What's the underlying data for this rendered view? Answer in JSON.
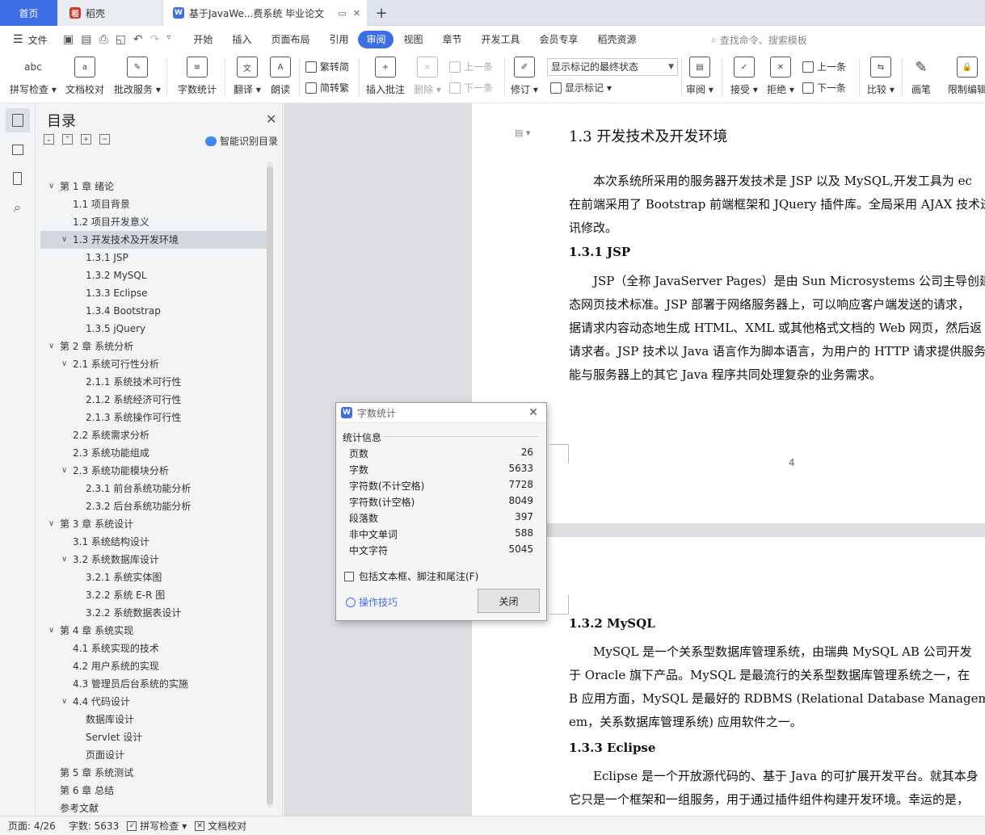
{
  "tabs": {
    "home": "首页",
    "daoke": "稻壳",
    "doc": "基于JavaWe...费系统 毕业论文"
  },
  "menu": {
    "file": "文件",
    "items": [
      "开始",
      "插入",
      "页面布局",
      "引用",
      "审阅",
      "视图",
      "章节",
      "开发工具",
      "会员专享",
      "稻壳资源"
    ],
    "active": "审阅",
    "search": "查找命令、搜索模板"
  },
  "ribbon": {
    "spell": "拼写检查",
    "doc_check": "文档校对",
    "batch": "批改服务",
    "word_count": "字数统计",
    "translate": "翻译",
    "read": "朗读",
    "trad": "繁转简",
    "simp": "简转繁",
    "insert_comment": "插入批注",
    "delete": "删除",
    "prev": "上一条",
    "next": "下一条",
    "revise": "修订",
    "markup_state": "显示标记的最终状态",
    "show_markup": "显示标记",
    "review": "审阅",
    "accept": "接受",
    "reject": "拒绝",
    "prev2": "上一条",
    "next2": "下一条",
    "compare": "比较",
    "pen": "画笔",
    "restrict": "限制编辑"
  },
  "toc": {
    "title": "目录",
    "smart": "智能识别目录",
    "items": [
      {
        "text": "第 1 章  绪论",
        "level": 1,
        "arrow": "v"
      },
      {
        "text": "1.1  项目背景",
        "level": 2
      },
      {
        "text": "1.2  项目开发意义",
        "level": 2
      },
      {
        "text": "1.3  开发技术及开发环境",
        "level": 2,
        "arrow": "v",
        "active": true
      },
      {
        "text": "1.3.1 JSP",
        "level": 3
      },
      {
        "text": "1.3.2     MySQL",
        "level": 3
      },
      {
        "text": "1.3.3     Eclipse",
        "level": 3
      },
      {
        "text": "1.3.4     Bootstrap",
        "level": 3
      },
      {
        "text": "1.3.5     jQuery",
        "level": 3
      },
      {
        "text": "第 2 章  系统分析",
        "level": 1,
        "arrow": "v"
      },
      {
        "text": "2.1  系统可行性分析",
        "level": 2,
        "arrow": "v"
      },
      {
        "text": "2.1.1 系统技术可行性",
        "level": 3
      },
      {
        "text": "2.1.2 系统经济可行性",
        "level": 3
      },
      {
        "text": "2.1.3 系统操作可行性",
        "level": 3
      },
      {
        "text": "2.2 系统需求分析",
        "level": 2
      },
      {
        "text": "2.3 系统功能组成",
        "level": 2
      },
      {
        "text": "2.3     系统功能模块分析",
        "level": 2,
        "arrow": "v"
      },
      {
        "text": "2.3.1     前台系统功能分析",
        "level": 3
      },
      {
        "text": "2.3.2     后台系统功能分析",
        "level": 3
      },
      {
        "text": "第 3 章  系统设计",
        "level": 1,
        "arrow": "v"
      },
      {
        "text": "3.1  系统结构设计",
        "level": 2
      },
      {
        "text": "3.2     系统数据库设计",
        "level": 2,
        "arrow": "v"
      },
      {
        "text": "3.2.1 系统实体图",
        "level": 3
      },
      {
        "text": "3.2.2 系统 E-R 图",
        "level": 3
      },
      {
        "text": "3.2.2  系统数据表设计",
        "level": 3
      },
      {
        "text": "第 4 章  系统实现",
        "level": 1,
        "arrow": "v"
      },
      {
        "text": "4.1  系统实现的技术",
        "level": 2
      },
      {
        "text": "4.2  用户系统的实现",
        "level": 2
      },
      {
        "text": "4.3  管理员后台系统的实施",
        "level": 2
      },
      {
        "text": "4.4  代码设计",
        "level": 2,
        "arrow": "v"
      },
      {
        "text": "数据库设计",
        "level": 3
      },
      {
        "text": "Servlet 设计",
        "level": 3
      },
      {
        "text": "页面设计",
        "level": 3
      },
      {
        "text": "第 5 章  系统测试",
        "level": 1
      },
      {
        "text": "第 6 章  总结",
        "level": 1
      },
      {
        "text": "参考文献",
        "level": 1
      }
    ]
  },
  "doc": {
    "h13": "1.3  开发技术及开发环境",
    "p1": [
      "本次系统所采用的服务器开发技术是 JSP 以及 MySQL,开发工具为 ec",
      "在前端采用了 Bootstrap 前端框架和 JQuery 插件库。全局采用 AJAX 技术进",
      "讯修改。"
    ],
    "h131": "1.3.1 JSP",
    "p2": [
      "JSP（全称 JavaServer Pages）是由 Sun Microsystems 公司主导创建的一",
      "态网页技术标准。JSP 部署于网络服务器上，可以响应客户端发送的请求，",
      "据请求内容动态地生成 HTML、XML 或其他格式文档的 Web 网页，然后返",
      "请求者。JSP 技术以 Java 语言作为脚本语言，为用户的 HTTP 请求提供服务",
      "能与服务器上的其它 Java 程序共同处理复杂的业务需求。"
    ],
    "page_num": "4",
    "h132": "1.3.2    MySQL",
    "p3": [
      "MySQL 是一个关系型数据库管理系统，由瑞典 MySQL AB 公司开发",
      "于  Oracle  旗下产品。MySQL 是最流行的关系型数据库管理系统之一，在",
      "B  应用方面，MySQL 是最好的  RDBMS  (Relational  Database  Management",
      "em，关系数据库管理系统) 应用软件之一。"
    ],
    "h133": "1.3.3    Eclipse",
    "p4": [
      "Eclipse  是一个开放源代码的、基于 Java 的可扩展开发平台。就其本身",
      "它只是一个框架和一组服务，用于通过插件组件构建开发环境。幸运的是，"
    ]
  },
  "dialog": {
    "title": "字数统计",
    "group": "统计信息",
    "stats": [
      {
        "label": "页数",
        "value": "26"
      },
      {
        "label": "字数",
        "value": "5633"
      },
      {
        "label": "字符数(不计空格)",
        "value": "7728"
      },
      {
        "label": "字符数(计空格)",
        "value": "8049"
      },
      {
        "label": "段落数",
        "value": "397"
      },
      {
        "label": "非中文单词",
        "value": "588"
      },
      {
        "label": "中文字符",
        "value": "5045"
      }
    ],
    "checkbox": "包括文本框、脚注和尾注(F)",
    "tips": "操作技巧",
    "close": "关闭"
  },
  "status": {
    "page": "页面: 4/26",
    "words": "字数: 5633",
    "spell": "拼写检查",
    "doc_check": "文档校对"
  },
  "colors": {
    "accent": "#3e6ee6",
    "canvas": "#dcdde0",
    "panel": "#f3f4f6"
  }
}
